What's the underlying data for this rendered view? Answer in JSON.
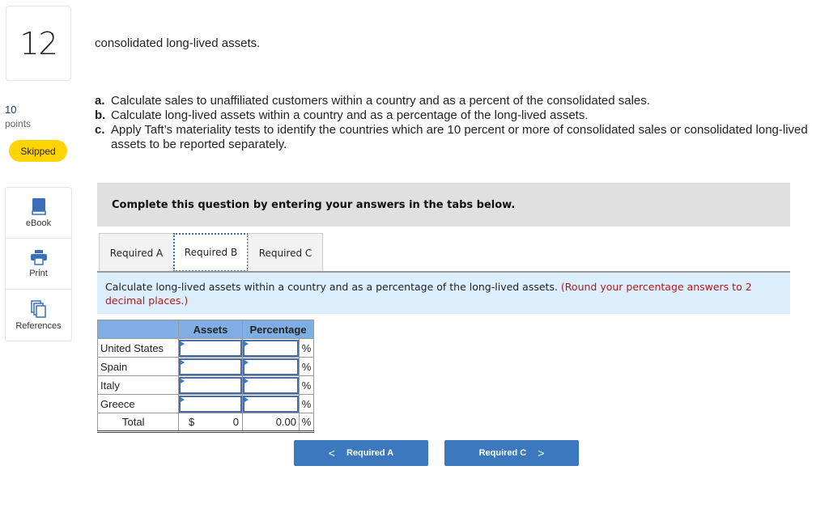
{
  "question": {
    "number": "12",
    "points_value": "10",
    "points_label": "points",
    "status": "Skipped"
  },
  "tools": [
    {
      "label": "eBook",
      "icon": "book-icon"
    },
    {
      "label": "Print",
      "icon": "printer-icon"
    },
    {
      "label": "References",
      "icon": "references-icon"
    }
  ],
  "intro": {
    "tail": "consolidated long-lived assets."
  },
  "requirements": [
    {
      "letter": "a.",
      "text": "Calculate sales to unaffiliated customers within a country and as a percent of the consolidated sales."
    },
    {
      "letter": "b.",
      "text": "Calculate long-lived assets within a country and as a percentage of the long-lived assets."
    },
    {
      "letter": "c.",
      "text": "Apply Taft’s materiality tests to identify the countries which are 10 percent or more of consolidated sales or consolidated long-lived"
    },
    {
      "letter": "",
      "text": "assets to be reported separately."
    }
  ],
  "instruction": "Complete this question by entering your answers in the tabs below.",
  "tabs": [
    {
      "label": "Required A",
      "active": false
    },
    {
      "label": "Required B",
      "active": true
    },
    {
      "label": "Required C",
      "active": false
    }
  ],
  "prompt": {
    "text": "Calculate long-lived assets within a country and as a percentage of the long-lived assets. ",
    "note": "(Round your percentage answers to 2 decimal places.)"
  },
  "table": {
    "headers": [
      "",
      "Assets",
      "Percentage"
    ],
    "rows": [
      {
        "label": "United States",
        "assets": "",
        "percentage": "",
        "unit": "%"
      },
      {
        "label": "Spain",
        "assets": "",
        "percentage": "",
        "unit": "%"
      },
      {
        "label": "Italy",
        "assets": "",
        "percentage": "",
        "unit": "%"
      },
      {
        "label": "Greece",
        "assets": "",
        "percentage": "",
        "unit": "%"
      }
    ],
    "total": {
      "label": "Total",
      "currency": "$",
      "assets": "0",
      "percentage": "0.00",
      "unit": "%"
    }
  },
  "nav": {
    "prev_label": "Required A",
    "next_label": "Required C",
    "prev_icon": "<",
    "next_icon": ">"
  }
}
